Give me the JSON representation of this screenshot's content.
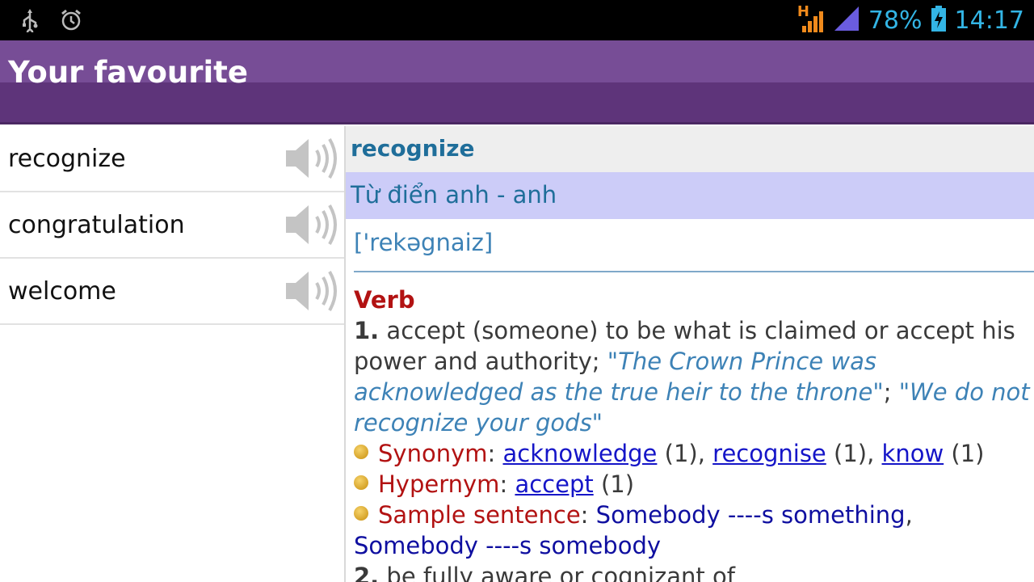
{
  "status_bar": {
    "network_label": "H",
    "battery_percent": "78%",
    "time": "14:17"
  },
  "action_bar": {
    "title": "Your favourite"
  },
  "favourites": [
    {
      "word": "recognize"
    },
    {
      "word": "congratulation"
    },
    {
      "word": "welcome"
    }
  ],
  "entry": {
    "headword": "recognize",
    "dictionary": "Từ điển anh - anh",
    "pronunciation": "['rekəgnaiz]",
    "part_of_speech": "Verb",
    "sense1": {
      "number": "1.",
      "definition": "accept (someone) to be what is claimed or accept his power and authority;",
      "example1": "\"The Crown Prince was acknowledged as the true heir to the throne\"",
      "separator": ";",
      "example2": "\"We do not recognize your gods\""
    },
    "synonym": {
      "label": "Synonym",
      "links": [
        {
          "word": "acknowledge",
          "count": "(1)"
        },
        {
          "word": "recognise",
          "count": "(1)"
        },
        {
          "word": "know",
          "count": "(1)"
        }
      ]
    },
    "hypernym": {
      "label": "Hypernym",
      "links": [
        {
          "word": "accept",
          "count": "(1)"
        }
      ]
    },
    "sample": {
      "label": "Sample sentence",
      "text1": "Somebody ----s something",
      "text2": "Somebody ----s somebody"
    },
    "sense2": {
      "number": "2.",
      "definition": "be fully aware or cognizant of"
    }
  },
  "colors": {
    "action_bar": "#774d96",
    "accent": "#33b5e5",
    "part_of_speech": "#b21212",
    "link": "#1515c8"
  }
}
